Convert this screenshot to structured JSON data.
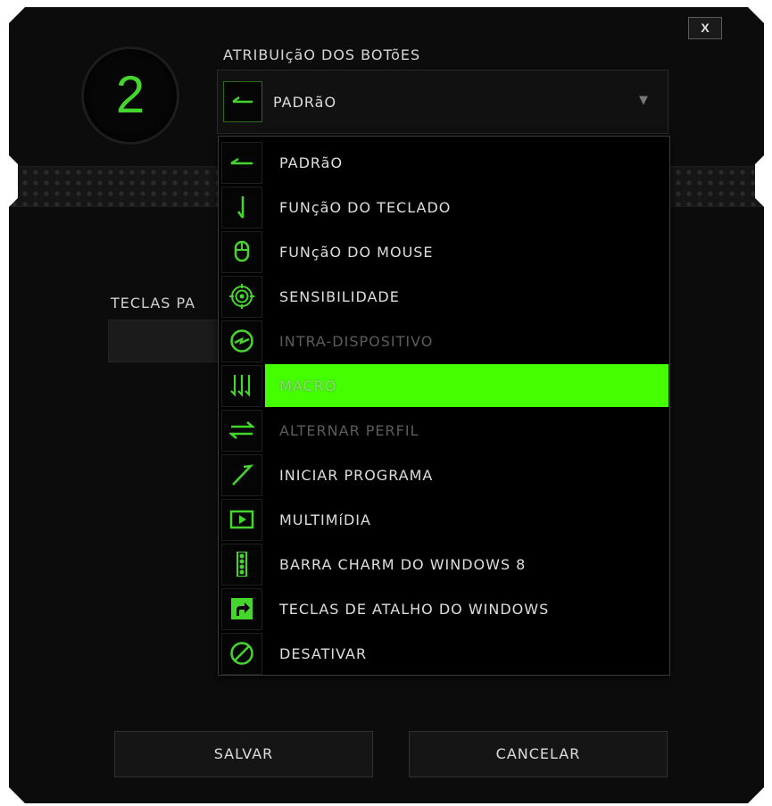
{
  "window": {
    "close_label": "X",
    "profile_number": "2",
    "title": "ATRIBUIçãO DOS BOTõES",
    "accent_color": "#44d62c",
    "highlight_color": "#44ff00"
  },
  "assignment_select": {
    "selected_label": "PADRãO",
    "selected_icon": "arrow-left-icon"
  },
  "keys_label": "TECLAS PA",
  "menu": {
    "items": [
      {
        "label": "PADRãO",
        "icon": "arrow-left-icon",
        "state": "normal"
      },
      {
        "label": "FUNçãO DO TECLADO",
        "icon": "arrow-down-icon",
        "state": "normal"
      },
      {
        "label": "FUNçãO DO MOUSE",
        "icon": "mouse-icon",
        "state": "normal"
      },
      {
        "label": "SENSIBILIDADE",
        "icon": "target-icon",
        "state": "normal"
      },
      {
        "label": "INTRA-DISPOSITIVO",
        "icon": "lightning-circle-icon",
        "state": "disabled"
      },
      {
        "label": "MACRO",
        "icon": "macro-arrows-icon",
        "state": "selected"
      },
      {
        "label": "ALTERNAR PERFIL",
        "icon": "swap-arrows-icon",
        "state": "disabled"
      },
      {
        "label": "INICIAR PROGRAMA",
        "icon": "diagonal-arrow-icon",
        "state": "normal"
      },
      {
        "label": "MULTIMíDIA",
        "icon": "play-icon",
        "state": "normal"
      },
      {
        "label": "BARRA CHARM DO WINDOWS 8",
        "icon": "charm-bar-icon",
        "state": "normal"
      },
      {
        "label": "TECLAS DE ATALHO DO WINDOWS",
        "icon": "shortcut-icon",
        "state": "normal"
      },
      {
        "label": "DESATIVAR",
        "icon": "disable-icon",
        "state": "normal"
      }
    ]
  },
  "buttons": {
    "save_label": "SALVAR",
    "cancel_label": "CANCELAR"
  }
}
